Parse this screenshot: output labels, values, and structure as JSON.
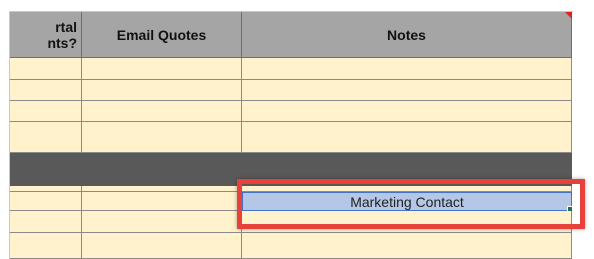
{
  "columns": {
    "partial_header": "rtal\nnts?",
    "email_quotes": "Email Quotes",
    "notes": "Notes"
  },
  "selected_cell": {
    "value": "Marketing Contact"
  },
  "colors": {
    "header_bg": "#a5a5a5",
    "row_bg": "#fff2cc",
    "section_bar": "#595959",
    "selection_bg": "#b4c7e7",
    "highlight_border": "#e8413b"
  }
}
